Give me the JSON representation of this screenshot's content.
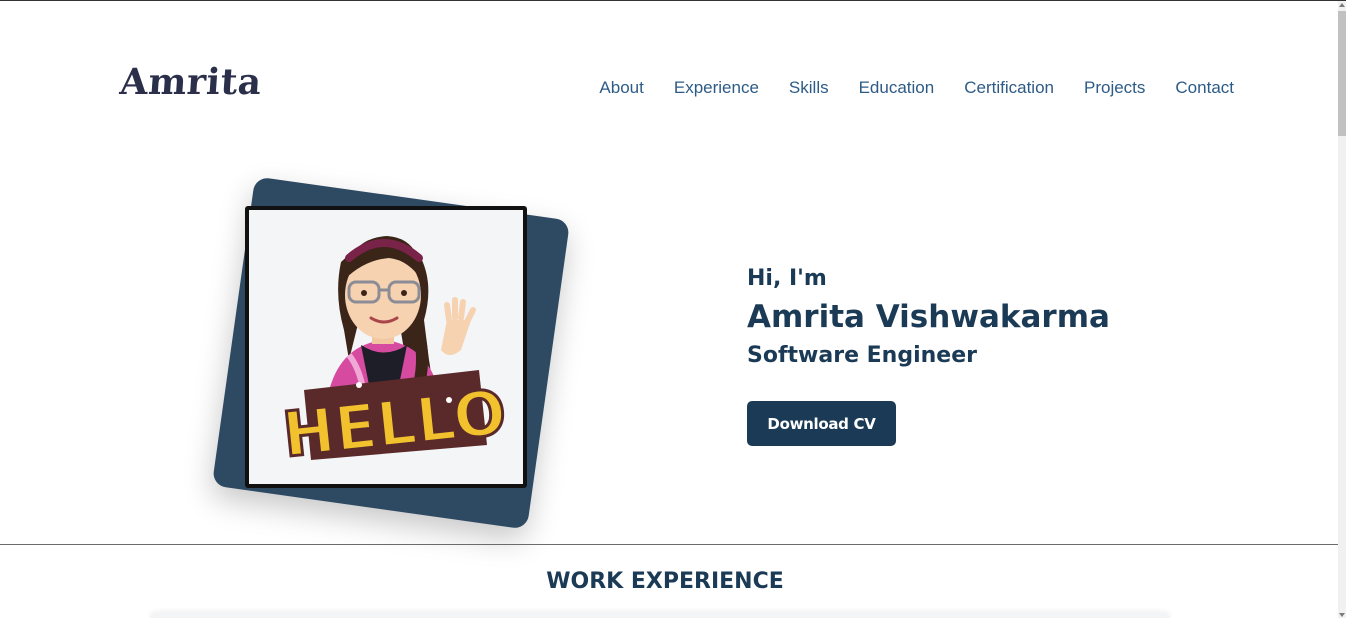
{
  "header": {
    "logo_text": "Amrita",
    "nav": [
      "About",
      "Experience",
      "Skills",
      "Education",
      "Certification",
      "Projects",
      "Contact"
    ]
  },
  "hero": {
    "greeting": "Hi, I'm",
    "name": "Amrita Vishwakarma",
    "role": "Software Engineer",
    "download_button": "Download CV",
    "avatar_sign": "HELLO"
  },
  "sections": {
    "work_experience_title": "WORK EXPERIENCE"
  },
  "colors": {
    "primary": "#1b3a55",
    "nav_link": "#2d5b86",
    "photo_backdrop": "#2e4a63"
  }
}
